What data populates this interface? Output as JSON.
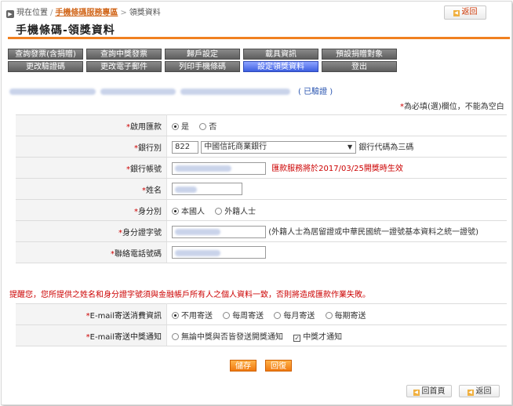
{
  "breadcrumb": {
    "current_label": "現在位置",
    "link": "手機條碼服務專區",
    "page": "領獎資料"
  },
  "top_back_label": "返回",
  "page_title": "手機條碼-領獎資料",
  "tabs": [
    {
      "label": "查詢發票(含捐贈)",
      "active": false
    },
    {
      "label": "查詢中獎發票",
      "active": false
    },
    {
      "label": "歸戶設定",
      "active": false
    },
    {
      "label": "載具資訊",
      "active": false
    },
    {
      "label": "預設捐贈對象",
      "active": false
    },
    {
      "label": "更改驗證碼",
      "active": false
    },
    {
      "label": "更改電子郵件",
      "active": false
    },
    {
      "label": "列印手機條碼",
      "active": false
    },
    {
      "label": "設定領獎資料",
      "active": true
    },
    {
      "label": "登出",
      "active": false
    }
  ],
  "info": {
    "verified_label": "( 已驗證 )"
  },
  "required_note": {
    "asterisk": "*",
    "text": "為必填(選)欄位，不能為空白"
  },
  "form": {
    "enable": {
      "label": "啟用匯款",
      "options": [
        "是",
        "否"
      ],
      "selected": 0
    },
    "bank": {
      "label": "銀行別",
      "code": "822",
      "name": "中國信託商業銀行",
      "note": "銀行代碼為三碼"
    },
    "account": {
      "label": "銀行帳號",
      "note": "匯款服務將於2017/03/25開獎時生效"
    },
    "name": {
      "label": "姓名"
    },
    "identity": {
      "label": "身分別",
      "options": [
        "本國人",
        "外籍人士"
      ],
      "selected": 0
    },
    "id_number": {
      "label": "身分證字號",
      "note": "(外籍人士為居留證或中華民國統一證號基本資料之統一證號)"
    },
    "phone": {
      "label": "聯絡電話號碼"
    },
    "email_invoice": {
      "label": "E-mail寄送消費資訊",
      "options": [
        "不用寄送",
        "每周寄送",
        "每月寄送",
        "每期寄送"
      ],
      "selected": 0
    },
    "email_prize": {
      "label": "E-mail寄送中獎通知",
      "options": [
        "無論中獎與否皆發送開獎通知",
        "中獎才通知"
      ],
      "selected": 1
    }
  },
  "warning": "提醒您，您所提供之姓名和身分證字號須與金融帳戶所有人之個人資料一致，否則將造成匯款作業失敗。",
  "actions": {
    "save": "儲存",
    "reset": "回復"
  },
  "bottom": {
    "home": "回首頁",
    "back": "返回"
  },
  "colors": {
    "accent_orange": "#f08020",
    "required_red": "#cc0000",
    "active_tab_blue": "#3d5fe0",
    "tab_gray": "#5e5e5e"
  }
}
